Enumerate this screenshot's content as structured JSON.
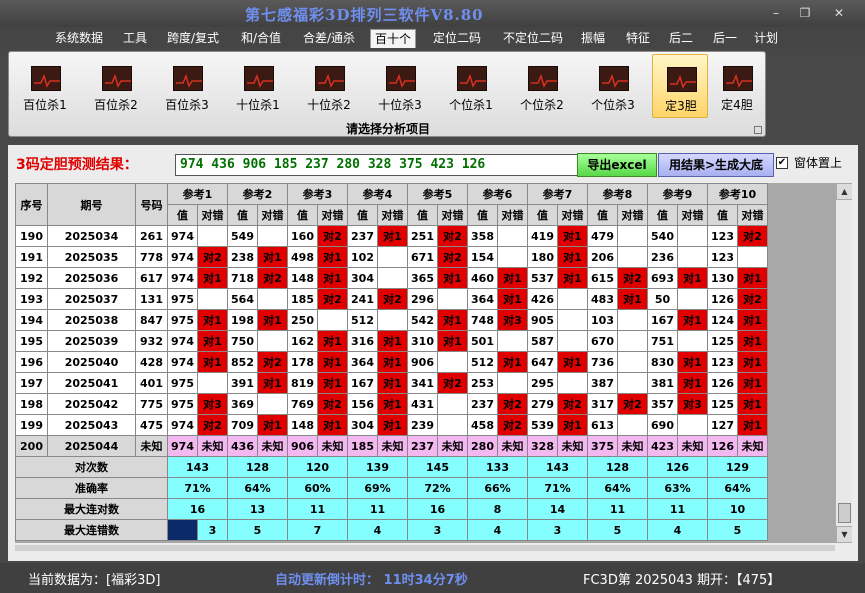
{
  "window": {
    "title": "第七感福彩3D排列三软件V8.80",
    "min_glyph": "–",
    "restore_glyph": "❐",
    "close_glyph": "✕"
  },
  "menu": [
    "系统数据",
    "工具",
    "跨度/复式",
    "和/合值",
    "合差/通杀",
    "百十个",
    "定位二码",
    "不定位二码",
    "振幅",
    "特征",
    "后二",
    "后一",
    "计划"
  ],
  "active_menu_index": 5,
  "ribbon": {
    "buttons": [
      "百位杀1",
      "百位杀2",
      "百位杀3",
      "十位杀1",
      "十位杀2",
      "十位杀3",
      "个位杀1",
      "个位杀2",
      "个位杀3",
      "定3胆",
      "定4胆"
    ],
    "active_index": 9,
    "caption": "请选择分析项目",
    "icon_name": "chart-icon"
  },
  "prediction": {
    "label": "3码定胆预测结果：",
    "value": "974 436 906 185 237 280 328 375 423 126",
    "export_button": "导出excel",
    "generate_button": "用结果>生成大底",
    "pin_checked": true,
    "pin_label": "窗体置上"
  },
  "table": {
    "col_headers": [
      "序号",
      "期号",
      "号码"
    ],
    "ref_headers": [
      "参考1",
      "参考2",
      "参考3",
      "参考4",
      "参考5",
      "参考6",
      "参考7",
      "参考8",
      "参考9",
      "参考10"
    ],
    "sub_headers": [
      "值",
      "对错"
    ],
    "rows": [
      {
        "seq": "190",
        "period": "2025034",
        "num": "261",
        "cells": [
          [
            "974",
            ""
          ],
          [
            "549",
            ""
          ],
          [
            "160",
            "对2"
          ],
          [
            "237",
            "对1"
          ],
          [
            "251",
            "对2"
          ],
          [
            "358",
            ""
          ],
          [
            "419",
            "对1"
          ],
          [
            "479",
            ""
          ],
          [
            "540",
            ""
          ],
          [
            "123",
            "对2"
          ]
        ]
      },
      {
        "seq": "191",
        "period": "2025035",
        "num": "778",
        "cells": [
          [
            "974",
            "对2"
          ],
          [
            "238",
            "对1"
          ],
          [
            "498",
            "对1"
          ],
          [
            "102",
            ""
          ],
          [
            "671",
            "对2"
          ],
          [
            "154",
            ""
          ],
          [
            "180",
            "对1"
          ],
          [
            "206",
            ""
          ],
          [
            "236",
            ""
          ],
          [
            "123",
            ""
          ]
        ]
      },
      {
        "seq": "192",
        "period": "2025036",
        "num": "617",
        "cells": [
          [
            "974",
            "对1"
          ],
          [
            "718",
            "对2"
          ],
          [
            "148",
            "对1"
          ],
          [
            "304",
            ""
          ],
          [
            "365",
            "对1"
          ],
          [
            "460",
            "对1"
          ],
          [
            "537",
            "对1"
          ],
          [
            "615",
            "对2"
          ],
          [
            "693",
            "对1"
          ],
          [
            "130",
            "对1"
          ]
        ]
      },
      {
        "seq": "193",
        "period": "2025037",
        "num": "131",
        "cells": [
          [
            "975",
            ""
          ],
          [
            "564",
            ""
          ],
          [
            "185",
            "对2"
          ],
          [
            "241",
            "对2"
          ],
          [
            "296",
            ""
          ],
          [
            "364",
            "对1"
          ],
          [
            "426",
            ""
          ],
          [
            "483",
            "对1"
          ],
          [
            "50",
            ""
          ],
          [
            "126",
            "对2"
          ]
        ]
      },
      {
        "seq": "194",
        "period": "2025038",
        "num": "847",
        "cells": [
          [
            "975",
            "对1"
          ],
          [
            "198",
            "对1"
          ],
          [
            "250",
            ""
          ],
          [
            "512",
            ""
          ],
          [
            "542",
            "对1"
          ],
          [
            "748",
            "对3"
          ],
          [
            "905",
            ""
          ],
          [
            "103",
            ""
          ],
          [
            "167",
            "对1"
          ],
          [
            "124",
            "对1"
          ]
        ]
      },
      {
        "seq": "195",
        "period": "2025039",
        "num": "932",
        "cells": [
          [
            "974",
            "对1"
          ],
          [
            "750",
            ""
          ],
          [
            "162",
            "对1"
          ],
          [
            "316",
            "对1"
          ],
          [
            "310",
            "对1"
          ],
          [
            "501",
            ""
          ],
          [
            "587",
            ""
          ],
          [
            "670",
            ""
          ],
          [
            "751",
            ""
          ],
          [
            "125",
            "对1"
          ]
        ]
      },
      {
        "seq": "196",
        "period": "2025040",
        "num": "428",
        "cells": [
          [
            "974",
            "对1"
          ],
          [
            "852",
            "对2"
          ],
          [
            "178",
            "对1"
          ],
          [
            "364",
            "对1"
          ],
          [
            "906",
            ""
          ],
          [
            "512",
            "对1"
          ],
          [
            "647",
            "对1"
          ],
          [
            "736",
            ""
          ],
          [
            "830",
            "对1"
          ],
          [
            "123",
            "对1"
          ]
        ]
      },
      {
        "seq": "197",
        "period": "2025041",
        "num": "401",
        "cells": [
          [
            "975",
            ""
          ],
          [
            "391",
            "对1"
          ],
          [
            "819",
            "对1"
          ],
          [
            "167",
            "对1"
          ],
          [
            "341",
            "对2"
          ],
          [
            "253",
            ""
          ],
          [
            "295",
            ""
          ],
          [
            "387",
            ""
          ],
          [
            "381",
            "对1"
          ],
          [
            "126",
            "对1"
          ]
        ]
      },
      {
        "seq": "198",
        "period": "2025042",
        "num": "775",
        "cells": [
          [
            "975",
            "对3"
          ],
          [
            "369",
            ""
          ],
          [
            "769",
            "对2"
          ],
          [
            "156",
            "对1"
          ],
          [
            "431",
            ""
          ],
          [
            "237",
            "对2"
          ],
          [
            "279",
            "对2"
          ],
          [
            "317",
            "对2"
          ],
          [
            "357",
            "对3"
          ],
          [
            "125",
            "对1"
          ]
        ]
      },
      {
        "seq": "199",
        "period": "2025043",
        "num": "475",
        "cells": [
          [
            "974",
            "对2"
          ],
          [
            "709",
            "对1"
          ],
          [
            "148",
            "对1"
          ],
          [
            "304",
            "对1"
          ],
          [
            "239",
            ""
          ],
          [
            "458",
            "对2"
          ],
          [
            "539",
            "对1"
          ],
          [
            "613",
            ""
          ],
          [
            "690",
            ""
          ],
          [
            "127",
            "对1"
          ]
        ]
      }
    ],
    "forecast_row": {
      "seq": "200",
      "period": "2025044",
      "num": "未知",
      "values": [
        "974",
        "436",
        "906",
        "185",
        "237",
        "280",
        "328",
        "375",
        "423",
        "126"
      ],
      "status": "未知"
    },
    "stats": [
      {
        "label": "对次数",
        "values": [
          "143",
          "128",
          "120",
          "139",
          "145",
          "133",
          "143",
          "128",
          "126",
          "129"
        ]
      },
      {
        "label": "准确率",
        "values": [
          "71%",
          "64%",
          "60%",
          "69%",
          "72%",
          "66%",
          "71%",
          "64%",
          "63%",
          "64%"
        ]
      },
      {
        "label": "最大连对数",
        "values": [
          "16",
          "13",
          "11",
          "11",
          "16",
          "8",
          "14",
          "11",
          "11",
          "10"
        ]
      },
      {
        "label": "最大连错数",
        "values": [
          "3",
          "5",
          "7",
          "4",
          "3",
          "4",
          "3",
          "5",
          "4",
          "5"
        ]
      }
    ]
  },
  "status": {
    "current_data": "当前数据为：[福彩3D]",
    "countdown": "自动更新倒计时：  11时34分7秒",
    "issue": "FC3D第 2025043 期开：【475】"
  }
}
